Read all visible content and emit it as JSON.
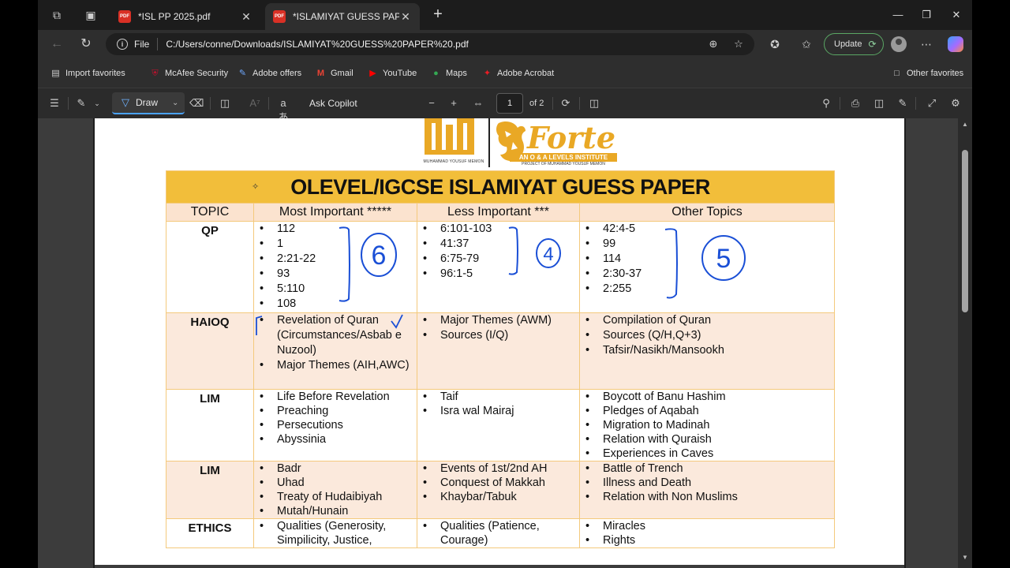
{
  "tabs": [
    {
      "title": "*ISL PP 2025.pdf",
      "active": false
    },
    {
      "title": "*ISLAMIYAT GUESS PAPER",
      "active": true
    }
  ],
  "address": {
    "scheme_label": "File",
    "url": "C:/Users/conne/Downloads/ISLAMIYAT%20GUESS%20PAPER%20.pdf"
  },
  "update_label": "Update",
  "favorites": [
    {
      "label": "Import favorites",
      "icon": "import-icon"
    },
    {
      "label": "McAfee Security",
      "icon": "mcafee-icon",
      "color": "#c8102e"
    },
    {
      "label": "Adobe offers",
      "icon": "adobe-offers-icon",
      "color": "#6fa8ff"
    },
    {
      "label": "Gmail",
      "icon": "gmail-icon",
      "color": "#ea4335"
    },
    {
      "label": "YouTube",
      "icon": "youtube-icon",
      "color": "#ff0000"
    },
    {
      "label": "Maps",
      "icon": "maps-icon",
      "color": "#34a853"
    },
    {
      "label": "Adobe Acrobat",
      "icon": "acrobat-icon",
      "color": "#ec1c24"
    }
  ],
  "other_favorites": "Other favorites",
  "pdf_toolbar": {
    "draw_label": "Draw",
    "copilot_label": "Ask Copilot",
    "page_current": "1",
    "page_total": "of 2"
  },
  "logo": {
    "left_caption": "MUHAMMAD YOUSUF MEMON",
    "brand": "Forte",
    "tagline": "AN O & A LEVELS INSTITUTE",
    "project": "PROJECT OF MUHAMMAD YOUSUF MEMON",
    "color": "#e9a825"
  },
  "paper": {
    "title": "OLEVEL/IGCSE ISLAMIYAT GUESS PAPER",
    "headers": [
      "TOPIC",
      "Most Important *****",
      "Less Important ***",
      "Other Topics"
    ],
    "rows": [
      {
        "topic": "QP",
        "most": [
          "112",
          "1",
          "2:21-22",
          "93",
          "5:110",
          "108"
        ],
        "less": [
          "6:101-103",
          "41:37",
          "6:75-79",
          "96:1-5"
        ],
        "other": [
          "42:4-5",
          "99",
          "114",
          "2:30-37",
          "2:255"
        ]
      },
      {
        "topic": "HAIOQ",
        "most": [
          "Revelation of Quran (Circumstances/Asbab e Nuzool)",
          "Major Themes (AIH,AWC)"
        ],
        "less": [
          "Major Themes (AWM)",
          "Sources (I/Q)"
        ],
        "other": [
          "Compilation of Quran",
          "Sources (Q/H,Q+3)",
          "Tafsir/Nasikh/Mansookh"
        ]
      },
      {
        "topic": "LIM",
        "most": [
          "Life Before Revelation",
          "Preaching",
          "Persecutions",
          "Abyssinia"
        ],
        "less": [
          "Taif",
          "Isra wal Mairaj"
        ],
        "other": [
          "Boycott of Banu Hashim",
          "Pledges of Aqabah",
          "Migration to Madinah",
          "Relation with Quraish",
          "Experiences in Caves"
        ]
      },
      {
        "topic": "LIM",
        "most": [
          "Badr",
          "Uhad",
          "Treaty of Hudaibiyah",
          "Mutah/Hunain"
        ],
        "less": [
          "Events of 1st/2nd AH",
          "Conquest of Makkah",
          "Khaybar/Tabuk"
        ],
        "other": [
          "Battle of Trench",
          "Illness and Death",
          "Relation with Non Muslims"
        ]
      },
      {
        "topic": "ETHICS",
        "most": [
          "Qualities (Generosity, Simpilicity, Justice,"
        ],
        "less": [
          "Qualities (Patience, Courage)"
        ],
        "other": [
          "Miracles",
          "Rights"
        ]
      }
    ],
    "annotations": [
      "6",
      "4",
      "5"
    ],
    "colors": {
      "title_bg": "#f2be3a",
      "header_bg": "#fbe3cf",
      "tint_row_bg": "#fbe9dc",
      "border": "#f4c97c",
      "ink": "#1a4fd6"
    }
  }
}
